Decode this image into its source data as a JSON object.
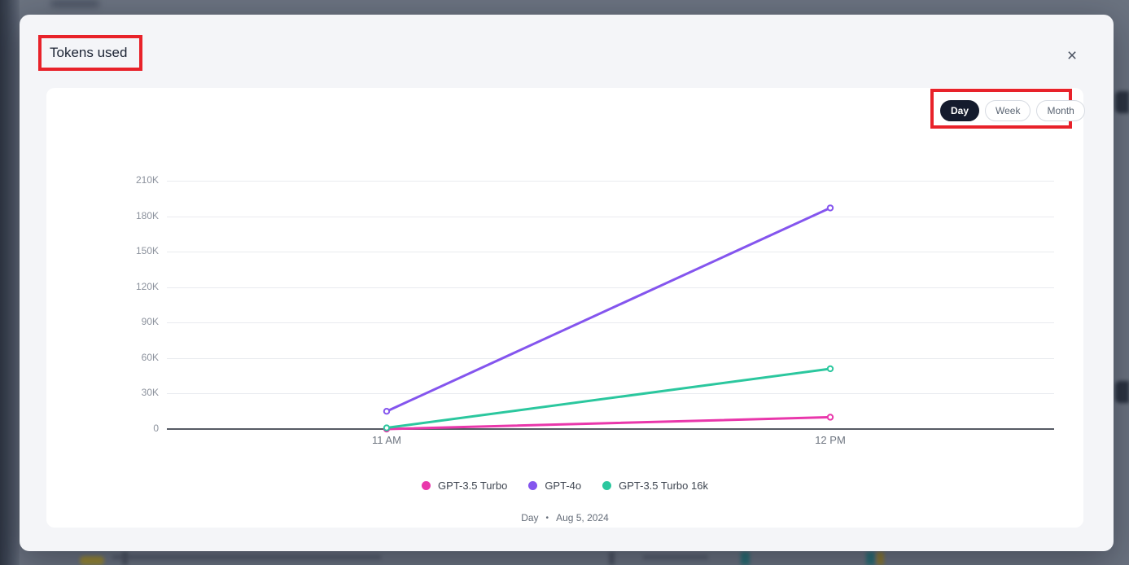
{
  "modal": {
    "title": "Tokens used",
    "close_icon": "×"
  },
  "toolbar": {
    "range_options": [
      {
        "label": "Day",
        "active": true
      },
      {
        "label": "Week",
        "active": false
      },
      {
        "label": "Month",
        "active": false
      }
    ]
  },
  "chart_data": {
    "type": "line",
    "x": [
      "11 AM",
      "12 PM"
    ],
    "series": [
      {
        "name": "GPT-3.5 Turbo",
        "color": "#e937ab",
        "values": [
          0,
          10000
        ]
      },
      {
        "name": "GPT-4o",
        "color": "#8455ee",
        "values": [
          15000,
          187000
        ]
      },
      {
        "name": "GPT-3.5 Turbo 16k",
        "color": "#2bc79e",
        "values": [
          1000,
          51000
        ]
      }
    ],
    "title": "Tokens used",
    "xlabel": "",
    "ylabel": "",
    "ylim": [
      0,
      210000
    ],
    "yticks": [
      0,
      30000,
      60000,
      90000,
      120000,
      150000,
      180000,
      210000
    ],
    "ytick_labels": [
      "0",
      "30K",
      "60K",
      "90K",
      "120K",
      "150K",
      "180K",
      "210K"
    ],
    "grid": true,
    "legend_position": "bottom"
  },
  "caption": {
    "period": "Day",
    "separator": "•",
    "date": "Aug 5, 2024"
  },
  "annotations": {
    "highlight_color": "#e8222a"
  }
}
